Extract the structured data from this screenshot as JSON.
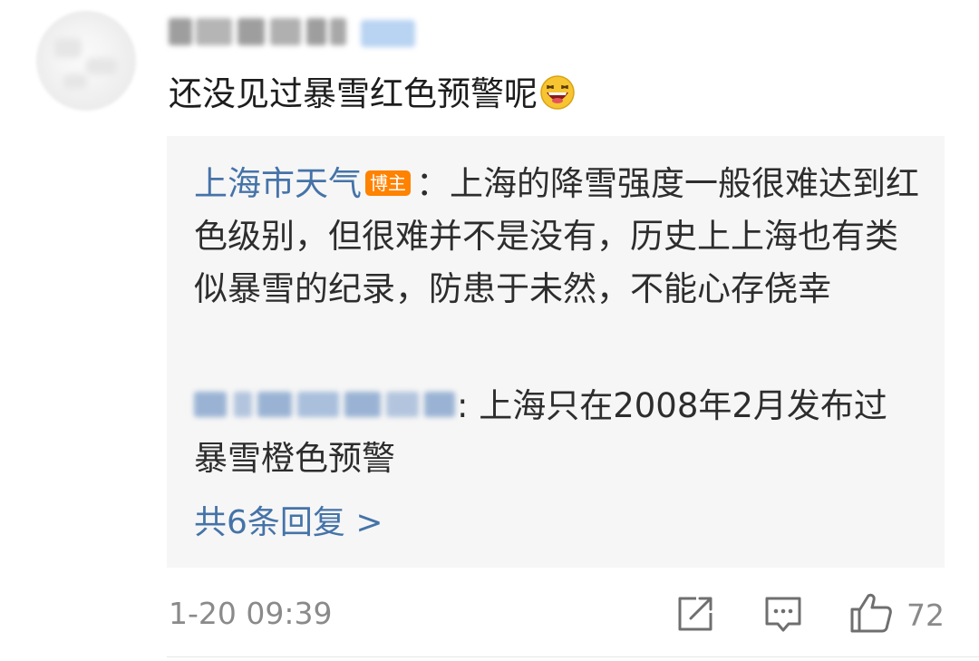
{
  "comment": {
    "text": "还没见过暴雪红色预警呢",
    "emoji": "laughing-emoji"
  },
  "replies": [
    {
      "author": "上海市天气",
      "badge": "博主",
      "separator": "：",
      "text": "上海的降雪强度一般很难达到红色级别，但很难并不是没有，历史上上海也有类似暴雪的纪录，防患于未然，不能心存侥幸"
    },
    {
      "separator": ":",
      "text": " 上海只在2008年2月发布过暴雪橙色预警"
    }
  ],
  "more_replies_label": "共6条回复 >",
  "footer": {
    "timestamp": "1-20 09:39",
    "like_count": "72",
    "icons": [
      "share-icon",
      "comment-icon",
      "thumbs-up-icon"
    ]
  },
  "colors": {
    "link_blue": "#4573a8",
    "badge_orange": "#ff8200",
    "reply_bg": "#f6f6f6",
    "meta_gray": "#8a8a8a"
  }
}
